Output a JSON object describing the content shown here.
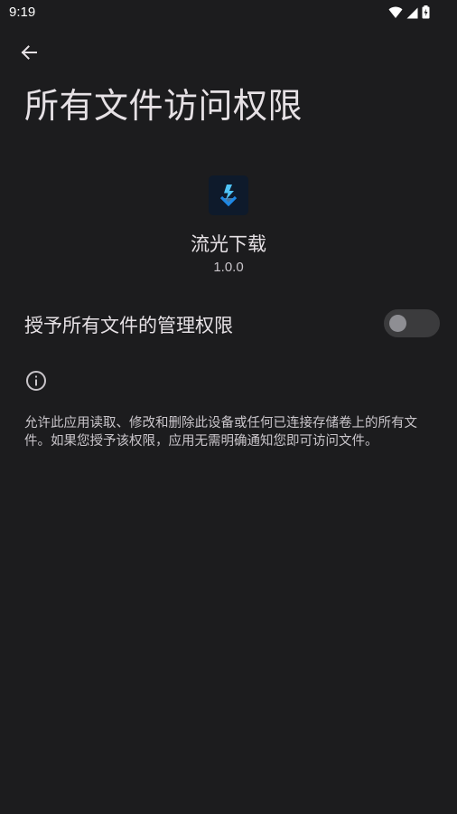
{
  "status_bar": {
    "time": "9:19",
    "icons": [
      "wifi-icon",
      "cellular-signal-icon",
      "battery-charging-icon"
    ]
  },
  "header": {
    "back_icon": "arrow-back-icon",
    "title": "所有文件访问权限"
  },
  "app": {
    "icon": "lightning-download-icon",
    "name": "流光下载",
    "version": "1.0.0"
  },
  "permission": {
    "label": "授予所有文件的管理权限",
    "enabled": false
  },
  "info": {
    "icon": "info-icon",
    "description": "允许此应用读取、修改和删除此设备或任何已连接存储卷上的所有文件。如果您授予该权限，应用无需明确通知您即可访问文件。"
  },
  "colors": {
    "background": "#1c1c1e",
    "text_primary": "#e6e1e5",
    "text_secondary": "#c9c5ca",
    "icon_accent": "#1e88e5",
    "toggle_track": "#3b3b3d",
    "toggle_thumb": "#8e8e93"
  }
}
